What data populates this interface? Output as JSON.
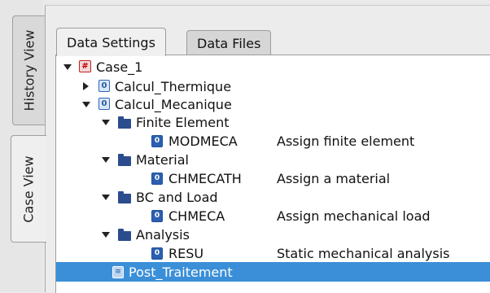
{
  "side_tabs": {
    "history_label": "History View",
    "case_label": "Case View"
  },
  "tabs": {
    "data_settings": "Data Settings",
    "data_files": "Data Files"
  },
  "tree": {
    "case": {
      "label": "Case_1",
      "icon": "case-icon"
    },
    "thermique": {
      "label": "Calcul_Thermique"
    },
    "mecanique": {
      "label": "Calcul_Mecanique"
    },
    "finite_element": {
      "label": "Finite Element",
      "cmd": "MODMECA",
      "desc": "Assign finite element"
    },
    "material": {
      "label": "Material",
      "cmd": "CHMECATH",
      "desc": "Assign a material"
    },
    "bc_load": {
      "label": "BC and Load",
      "cmd": "CHMECA",
      "desc": "Assign mechanical load"
    },
    "analysis": {
      "label": "Analysis",
      "cmd": "RESU",
      "desc": "Static mechanical analysis"
    },
    "post": {
      "label": "Post_Traitement"
    }
  },
  "colors": {
    "selection": "#3a8fd8",
    "folder": "#2b4c8d",
    "case_icon": "#c02020"
  }
}
